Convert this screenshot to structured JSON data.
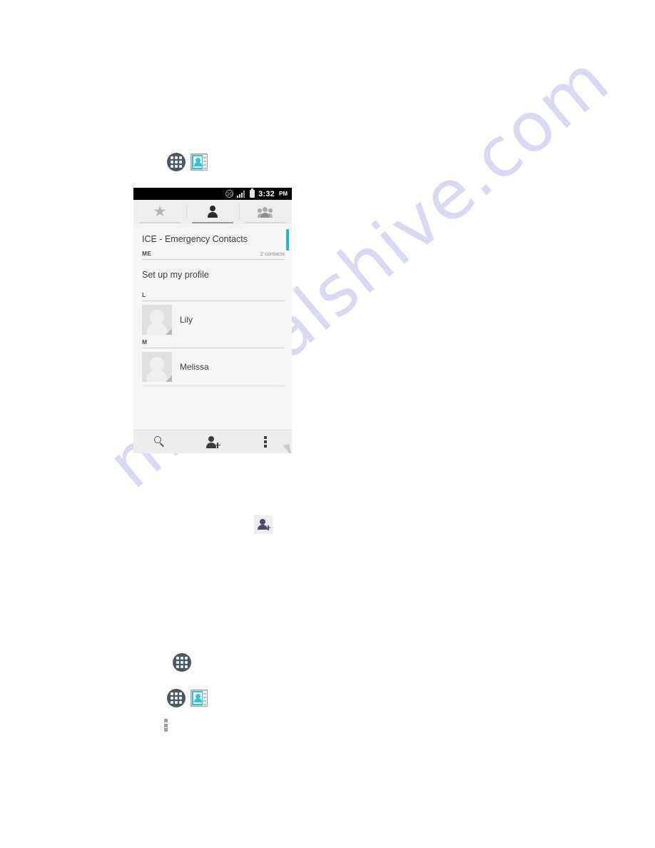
{
  "page": {
    "watermark": "manualshive.com"
  },
  "doc_icons": {
    "app_drawer": "app-drawer-icon",
    "contacts_app": "contacts-app-icon",
    "add_contact": "add-contact-icon",
    "overflow_menu": "overflow-menu-icon"
  },
  "screenshot": {
    "status_bar": {
      "network_label": "3G",
      "time": "3:32",
      "meridiem": "PM",
      "signal_icon": "signal-bars-icon",
      "battery_icon": "battery-icon"
    },
    "tabs": [
      {
        "name": "favorites",
        "icon": "star-icon",
        "active": false
      },
      {
        "name": "contacts",
        "icon": "person-icon",
        "active": true
      },
      {
        "name": "groups",
        "icon": "group-icon",
        "active": false
      }
    ],
    "list": {
      "account_title": "ICE - Emergency Contacts",
      "sections": [
        {
          "label": "ME",
          "count": "2 contacts"
        },
        {
          "label": "L",
          "count": ""
        },
        {
          "label": "M",
          "count": ""
        }
      ],
      "profile_row_label": "Set up my profile",
      "contacts": [
        {
          "name": "Lily",
          "avatar": "default-avatar"
        },
        {
          "name": "Melissa",
          "avatar": "default-avatar"
        }
      ],
      "scrollbar_color": "#27b0dd"
    },
    "bottom_bar": {
      "search_icon": "search-icon",
      "add_contact_icon": "add-contact-icon",
      "overflow_icon": "overflow-menu-icon"
    }
  }
}
